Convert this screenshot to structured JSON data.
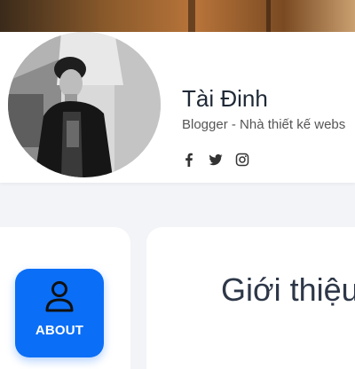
{
  "profile": {
    "name": "Tài Đinh",
    "tagline": "Blogger - Nhà thiết kế webs",
    "socials": [
      {
        "icon": "facebook-icon"
      },
      {
        "icon": "twitter-icon"
      },
      {
        "icon": "instagram-icon"
      }
    ]
  },
  "nav": {
    "about_label": "ABOUT",
    "about_icon": "person-icon"
  },
  "main": {
    "section_title": "Giới thiệu"
  },
  "colors": {
    "accent": "#0b6ef6",
    "background": "#f2f4f7",
    "card": "#ffffff",
    "text_dark": "#1f2937"
  }
}
